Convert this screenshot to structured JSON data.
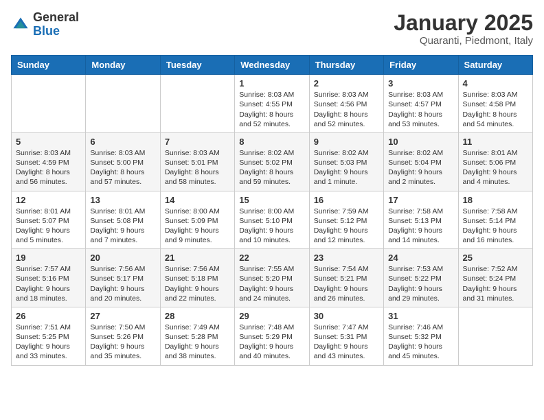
{
  "header": {
    "logo_general": "General",
    "logo_blue": "Blue",
    "month_title": "January 2025",
    "subtitle": "Quaranti, Piedmont, Italy"
  },
  "weekdays": [
    "Sunday",
    "Monday",
    "Tuesday",
    "Wednesday",
    "Thursday",
    "Friday",
    "Saturday"
  ],
  "weeks": [
    [
      {
        "day": "",
        "info": ""
      },
      {
        "day": "",
        "info": ""
      },
      {
        "day": "",
        "info": ""
      },
      {
        "day": "1",
        "info": "Sunrise: 8:03 AM\nSunset: 4:55 PM\nDaylight: 8 hours\nand 52 minutes."
      },
      {
        "day": "2",
        "info": "Sunrise: 8:03 AM\nSunset: 4:56 PM\nDaylight: 8 hours\nand 52 minutes."
      },
      {
        "day": "3",
        "info": "Sunrise: 8:03 AM\nSunset: 4:57 PM\nDaylight: 8 hours\nand 53 minutes."
      },
      {
        "day": "4",
        "info": "Sunrise: 8:03 AM\nSunset: 4:58 PM\nDaylight: 8 hours\nand 54 minutes."
      }
    ],
    [
      {
        "day": "5",
        "info": "Sunrise: 8:03 AM\nSunset: 4:59 PM\nDaylight: 8 hours\nand 56 minutes."
      },
      {
        "day": "6",
        "info": "Sunrise: 8:03 AM\nSunset: 5:00 PM\nDaylight: 8 hours\nand 57 minutes."
      },
      {
        "day": "7",
        "info": "Sunrise: 8:03 AM\nSunset: 5:01 PM\nDaylight: 8 hours\nand 58 minutes."
      },
      {
        "day": "8",
        "info": "Sunrise: 8:02 AM\nSunset: 5:02 PM\nDaylight: 8 hours\nand 59 minutes."
      },
      {
        "day": "9",
        "info": "Sunrise: 8:02 AM\nSunset: 5:03 PM\nDaylight: 9 hours\nand 1 minute."
      },
      {
        "day": "10",
        "info": "Sunrise: 8:02 AM\nSunset: 5:04 PM\nDaylight: 9 hours\nand 2 minutes."
      },
      {
        "day": "11",
        "info": "Sunrise: 8:01 AM\nSunset: 5:06 PM\nDaylight: 9 hours\nand 4 minutes."
      }
    ],
    [
      {
        "day": "12",
        "info": "Sunrise: 8:01 AM\nSunset: 5:07 PM\nDaylight: 9 hours\nand 5 minutes."
      },
      {
        "day": "13",
        "info": "Sunrise: 8:01 AM\nSunset: 5:08 PM\nDaylight: 9 hours\nand 7 minutes."
      },
      {
        "day": "14",
        "info": "Sunrise: 8:00 AM\nSunset: 5:09 PM\nDaylight: 9 hours\nand 9 minutes."
      },
      {
        "day": "15",
        "info": "Sunrise: 8:00 AM\nSunset: 5:10 PM\nDaylight: 9 hours\nand 10 minutes."
      },
      {
        "day": "16",
        "info": "Sunrise: 7:59 AM\nSunset: 5:12 PM\nDaylight: 9 hours\nand 12 minutes."
      },
      {
        "day": "17",
        "info": "Sunrise: 7:58 AM\nSunset: 5:13 PM\nDaylight: 9 hours\nand 14 minutes."
      },
      {
        "day": "18",
        "info": "Sunrise: 7:58 AM\nSunset: 5:14 PM\nDaylight: 9 hours\nand 16 minutes."
      }
    ],
    [
      {
        "day": "19",
        "info": "Sunrise: 7:57 AM\nSunset: 5:16 PM\nDaylight: 9 hours\nand 18 minutes."
      },
      {
        "day": "20",
        "info": "Sunrise: 7:56 AM\nSunset: 5:17 PM\nDaylight: 9 hours\nand 20 minutes."
      },
      {
        "day": "21",
        "info": "Sunrise: 7:56 AM\nSunset: 5:18 PM\nDaylight: 9 hours\nand 22 minutes."
      },
      {
        "day": "22",
        "info": "Sunrise: 7:55 AM\nSunset: 5:20 PM\nDaylight: 9 hours\nand 24 minutes."
      },
      {
        "day": "23",
        "info": "Sunrise: 7:54 AM\nSunset: 5:21 PM\nDaylight: 9 hours\nand 26 minutes."
      },
      {
        "day": "24",
        "info": "Sunrise: 7:53 AM\nSunset: 5:22 PM\nDaylight: 9 hours\nand 29 minutes."
      },
      {
        "day": "25",
        "info": "Sunrise: 7:52 AM\nSunset: 5:24 PM\nDaylight: 9 hours\nand 31 minutes."
      }
    ],
    [
      {
        "day": "26",
        "info": "Sunrise: 7:51 AM\nSunset: 5:25 PM\nDaylight: 9 hours\nand 33 minutes."
      },
      {
        "day": "27",
        "info": "Sunrise: 7:50 AM\nSunset: 5:26 PM\nDaylight: 9 hours\nand 35 minutes."
      },
      {
        "day": "28",
        "info": "Sunrise: 7:49 AM\nSunset: 5:28 PM\nDaylight: 9 hours\nand 38 minutes."
      },
      {
        "day": "29",
        "info": "Sunrise: 7:48 AM\nSunset: 5:29 PM\nDaylight: 9 hours\nand 40 minutes."
      },
      {
        "day": "30",
        "info": "Sunrise: 7:47 AM\nSunset: 5:31 PM\nDaylight: 9 hours\nand 43 minutes."
      },
      {
        "day": "31",
        "info": "Sunrise: 7:46 AM\nSunset: 5:32 PM\nDaylight: 9 hours\nand 45 minutes."
      },
      {
        "day": "",
        "info": ""
      }
    ]
  ]
}
